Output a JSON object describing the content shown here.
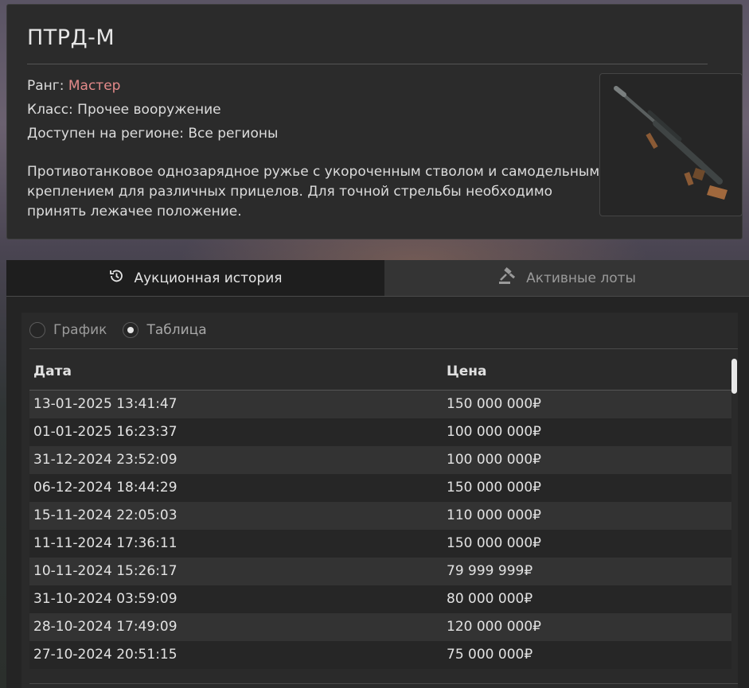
{
  "item": {
    "title": "ПТРД-М",
    "rank_label": "Ранг:",
    "rank_value": "Мастер",
    "class_line": "Класс: Прочее вооружение",
    "region_line": "Доступен на регионе: Все регионы",
    "description": "Противотанковое однозарядное ружье с укороченным стволом и самодельным креплением для различных прицелов. Для точной стрельбы необходимо принять лежачее положение.",
    "rank_color": "#e48a8a"
  },
  "tabs": [
    {
      "label": "Аукционная история",
      "icon": "history-icon",
      "active": true
    },
    {
      "label": "Активные лоты",
      "icon": "gavel-icon",
      "active": false
    }
  ],
  "view": {
    "chart_label": "График",
    "table_label": "Таблица",
    "selected": "Таблица"
  },
  "table": {
    "headers": [
      "Дата",
      "Цена"
    ],
    "rows": [
      [
        "13-01-2025 13:41:47",
        "150 000 000₽"
      ],
      [
        "01-01-2025 16:23:37",
        "100 000 000₽"
      ],
      [
        "31-12-2024 23:52:09",
        "100 000 000₽"
      ],
      [
        "06-12-2024 18:44:29",
        "150 000 000₽"
      ],
      [
        "15-11-2024 22:05:03",
        "110 000 000₽"
      ],
      [
        "11-11-2024 17:36:11",
        "150 000 000₽"
      ],
      [
        "10-11-2024 15:26:17",
        "79 999 999₽"
      ],
      [
        "31-10-2024 03:59:09",
        "80 000 000₽"
      ],
      [
        "28-10-2024 17:49:09",
        "120 000 000₽"
      ],
      [
        "27-10-2024 20:51:15",
        "75 000 000₽"
      ]
    ]
  }
}
